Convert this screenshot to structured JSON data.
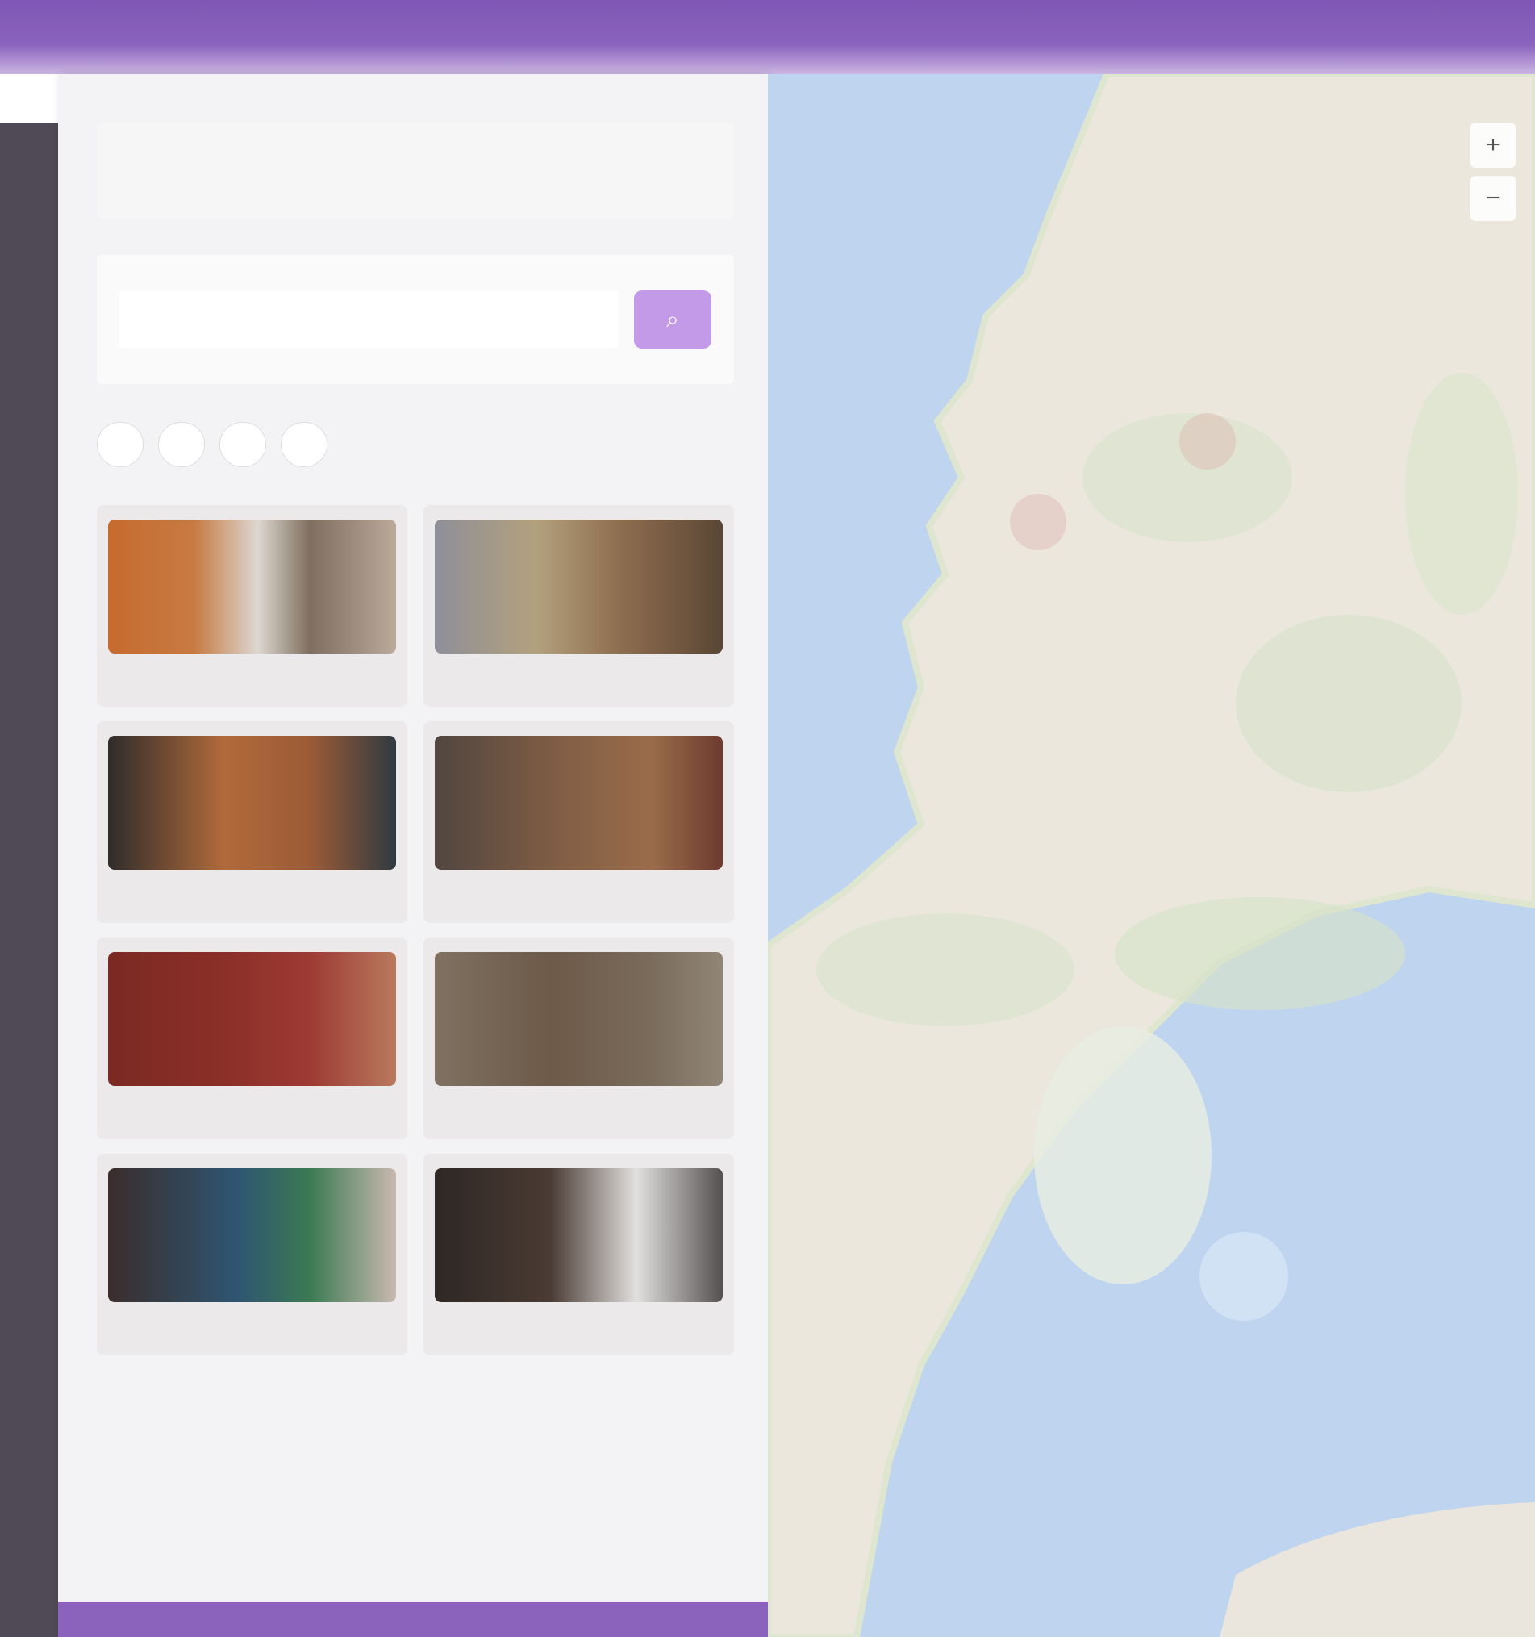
{
  "app": {
    "title": "",
    "accent_color": "#8b63bd",
    "rail_color": "#4f4a55",
    "map_water_color": "#bfd4ef",
    "map_land_color": "#ece7dc"
  },
  "sidebar": {
    "search_title": "",
    "search_placeholder": "",
    "search_button_icon": "search-icon",
    "filters": [
      {
        "label": ""
      },
      {
        "label": ""
      },
      {
        "label": ""
      },
      {
        "label": ""
      }
    ],
    "results": [
      {
        "title": ""
      },
      {
        "title": ""
      },
      {
        "title": ""
      },
      {
        "title": ""
      },
      {
        "title": ""
      },
      {
        "title": ""
      },
      {
        "title": ""
      },
      {
        "title": ""
      }
    ]
  },
  "map": {
    "zoom_in_icon": "plus-icon",
    "zoom_out_icon": "minus-icon"
  }
}
